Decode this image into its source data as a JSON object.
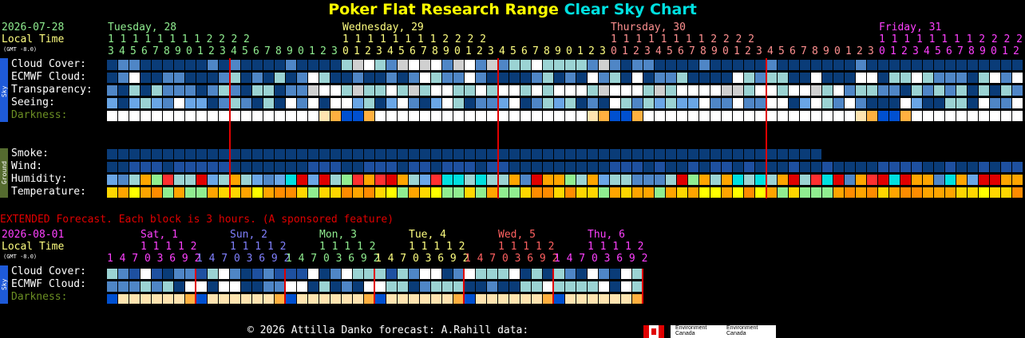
{
  "header": {
    "title_part1": "Poker Flat Research Range",
    "title_part2": "Clear Sky Chart",
    "date": "2026-07-28",
    "local_time": "Local Time",
    "gmt": "(GMT -8.0)"
  },
  "days": [
    {
      "label": "Tuesday, 28",
      "color": "#90ee90"
    },
    {
      "label": "Wednesday, 29",
      "color": "#ffff80"
    },
    {
      "label": "Thursday, 30",
      "color": "#ff9090"
    },
    {
      "label": "Friday, 31",
      "color": "#ff40ff"
    }
  ],
  "hours_row1": "1 1 1 1 1 1 1 1 2 2 2 2",
  "sky_rows": [
    "Cloud Cover:",
    "ECMWF Cloud:",
    "Transparency:",
    "Seeing:",
    "Darkness:"
  ],
  "ground_rows": [
    "Smoke:",
    "Wind:",
    "Humidity:",
    "Temperature:"
  ],
  "sky_tag": "Sky",
  "ground_tag": "Ground",
  "extended": {
    "notice": "EXTENDED Forecast. Each block is 3 hours. (A sponsored feature)",
    "date": "2026-08-01",
    "local_time": "Local Time",
    "gmt": "(GMT -8.0)",
    "days": [
      {
        "label": "Sat, 1",
        "color": "#ff40ff"
      },
      {
        "label": "Sun, 2",
        "color": "#8080ff"
      },
      {
        "label": "Mon, 3",
        "color": "#90ee90"
      },
      {
        "label": "Tue, 4",
        "color": "#ffff80"
      },
      {
        "label": "Wed, 5",
        "color": "#ff6060"
      },
      {
        "label": "Thu, 6",
        "color": "#ff40ff"
      }
    ],
    "hours_top": "1 1 1 1 2",
    "hours_bottom": "1 4 7 0 3 6 9 2",
    "rows": [
      "Cloud Cover:",
      "ECMWF Cloud:",
      "Darkness:"
    ]
  },
  "footer": {
    "text": "© 2026 Attilla Danko  forecast: A.Rahill  data:",
    "logo_line1": "Environment",
    "logo_line2": "Canada"
  },
  "colors": {
    "cloud_clear": "#0a3c78",
    "cloud_mid": "#4f86c6",
    "cloud_light": "#9bd3d3",
    "cloud_white": "#ffffff",
    "seeing_good": "#6aa6e6",
    "dark_day": "#ffffff",
    "dark_twilight": "#ffe4b0",
    "dark_night": "#0050d0",
    "red_line": "#e00000"
  }
}
